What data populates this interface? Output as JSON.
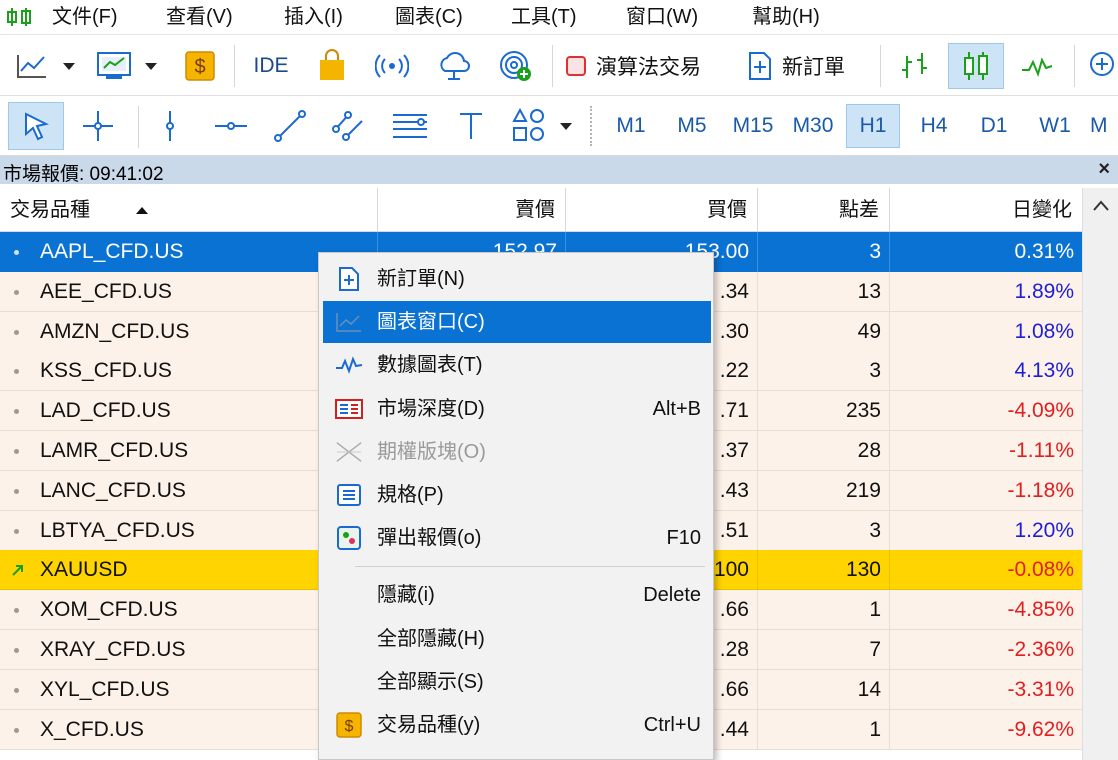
{
  "menubar": {
    "items": [
      {
        "label": "文件(F)"
      },
      {
        "label": "查看(V)"
      },
      {
        "label": "插入(I)"
      },
      {
        "label": "圖表(C)"
      },
      {
        "label": "工具(T)"
      },
      {
        "label": "窗口(W)"
      },
      {
        "label": "幫助(H)"
      }
    ]
  },
  "toolbar1": {
    "ide_label": "IDE",
    "algo_trading_label": "演算法交易",
    "new_order_label": "新訂單"
  },
  "toolbar2": {
    "timeframes": [
      "M1",
      "M5",
      "M15",
      "M30",
      "H1",
      "H4",
      "D1",
      "W1",
      "M"
    ],
    "active_timeframe": "H1"
  },
  "market_watch": {
    "title": "市場報價: 09:41:02",
    "close_icon": "×",
    "columns": {
      "symbol": "交易品種",
      "bid": "賣價",
      "ask": "買價",
      "spread": "點差",
      "daily_change": "日變化"
    },
    "rows": [
      {
        "symbol": "AAPL_CFD.US",
        "bid": "152.97",
        "ask": "153.00",
        "spread": "3",
        "change": "0.31%",
        "state": "selected"
      },
      {
        "symbol": "AEE_CFD.US",
        "bid": "",
        "ask": ".34",
        "spread": "13",
        "change": "1.89%"
      },
      {
        "symbol": "AMZN_CFD.US",
        "bid": "",
        "ask": ".30",
        "spread": "49",
        "change": "1.08%"
      },
      {
        "symbol": "KSS_CFD.US",
        "bid": "",
        "ask": ".22",
        "spread": "3",
        "change": "4.13%"
      },
      {
        "symbol": "LAD_CFD.US",
        "bid": "",
        "ask": ".71",
        "spread": "235",
        "change": "-4.09%"
      },
      {
        "symbol": "LAMR_CFD.US",
        "bid": "",
        "ask": ".37",
        "spread": "28",
        "change": "-1.11%"
      },
      {
        "symbol": "LANC_CFD.US",
        "bid": "",
        "ask": ".43",
        "spread": "219",
        "change": "-1.18%"
      },
      {
        "symbol": "LBTYA_CFD.US",
        "bid": "",
        "ask": ".51",
        "spread": "3",
        "change": "1.20%"
      },
      {
        "symbol": "XAUUSD",
        "bid": "",
        "ask": "100",
        "spread": "130",
        "change": "-0.08%",
        "state": "highlight"
      },
      {
        "symbol": "XOM_CFD.US",
        "bid": "",
        "ask": ".66",
        "spread": "1",
        "change": "-4.85%"
      },
      {
        "symbol": "XRAY_CFD.US",
        "bid": "",
        "ask": ".28",
        "spread": "7",
        "change": "-2.36%"
      },
      {
        "symbol": "XYL_CFD.US",
        "bid": "",
        "ask": ".66",
        "spread": "14",
        "change": "-3.31%"
      },
      {
        "symbol": "X_CFD.US",
        "bid": "",
        "ask": ".44",
        "spread": "1",
        "change": "-9.62%"
      }
    ]
  },
  "context_menu": {
    "items": [
      {
        "label": "新訂單(N)",
        "shortcut": "",
        "icon": "new-order-icon"
      },
      {
        "label": "圖表窗口(C)",
        "shortcut": "",
        "icon": "chart-window-icon",
        "state": "hover"
      },
      {
        "label": "數據圖表(T)",
        "shortcut": "",
        "icon": "tick-chart-icon"
      },
      {
        "label": "市場深度(D)",
        "shortcut": "Alt+B",
        "icon": "market-depth-icon"
      },
      {
        "label": "期權版塊(O)",
        "shortcut": "",
        "icon": "options-board-icon",
        "state": "disabled"
      },
      {
        "label": "規格(P)",
        "shortcut": "",
        "icon": "specification-icon"
      },
      {
        "label": "彈出報價(o)",
        "shortcut": "F10",
        "icon": "popup-prices-icon"
      },
      {
        "label": "隱藏(i)",
        "shortcut": "Delete",
        "icon": ""
      },
      {
        "label": "全部隱藏(H)",
        "shortcut": "",
        "icon": ""
      },
      {
        "label": "全部顯示(S)",
        "shortcut": "",
        "icon": ""
      },
      {
        "label": "交易品種(y)",
        "shortcut": "Ctrl+U",
        "icon": "symbols-icon"
      }
    ]
  },
  "colors": {
    "selection": "#0a72d2",
    "highlight": "#ffd400",
    "positive": "#1e1ed6",
    "negative": "#e02020",
    "row_bg": "#fdf2e9"
  }
}
